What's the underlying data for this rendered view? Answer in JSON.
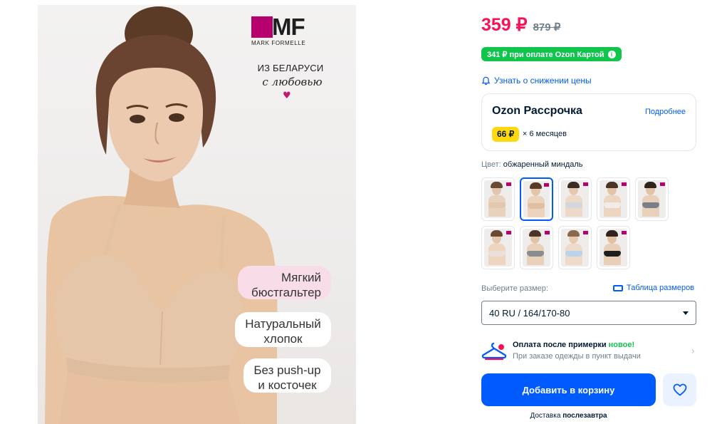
{
  "product_image": {
    "logo_letters": "MF",
    "logo_name": "MARK FORMELLE",
    "from_line": "ИЗ БЕЛАРУСИ",
    "love_line": "с любовью",
    "heart_icon": "heart-icon",
    "bubbles": [
      {
        "line1": "Мягкий",
        "line2": "бюстгальтер"
      },
      {
        "line1": "Натуральный",
        "line2": "хлопок"
      },
      {
        "line1": "Без push-up",
        "line2": "и косточек"
      }
    ]
  },
  "price": {
    "current": "359 ₽",
    "old": "879 ₽",
    "ozon_card_text": "341 ₽ при оплате Ozon Картой",
    "info_icon": "info-icon",
    "alert_text": "Узнать о снижении цены",
    "alert_icon": "bell-icon"
  },
  "installment": {
    "title": "Ozon Рассрочка",
    "more_link": "Подробнее",
    "amount": "66 ₽",
    "term": "× 6 месяцев"
  },
  "color": {
    "label": "Цвет:",
    "value": "обжаренный миндаль",
    "selected_index": 1,
    "swatches": [
      {
        "skin": "#e2c6ad",
        "hair": "#6b4a33",
        "body": "#e8d2bd",
        "bra": "#e3c8b0"
      },
      {
        "skin": "#e5c5a8",
        "hair": "#5a3b27",
        "body": "#ecd3bd",
        "bra": "#e2bfa0"
      },
      {
        "skin": "#e6c8ae",
        "hair": "#3d2c21",
        "body": "#edd9c7",
        "bra": "#d3d6dc"
      },
      {
        "skin": "#e4c4a6",
        "hair": "#4a3526",
        "body": "#ecd6c2",
        "bra": "#f1ece7"
      },
      {
        "skin": "#e3c3a5",
        "hair": "#2f231b",
        "body": "#e8d0ba",
        "bra": "#7b8088"
      },
      {
        "skin": "#e6c7ab",
        "hair": "#6b4a33",
        "body": "#edd5c0",
        "bra": "#eadfda"
      },
      {
        "skin": "#e3c3a6",
        "hair": "#4a3526",
        "body": "#e9d0bb",
        "bra": "#8a8c8f"
      },
      {
        "skin": "#e7cab0",
        "hair": "#8a6a4d",
        "body": "#eddacb",
        "bra": "#bcd1ea"
      },
      {
        "skin": "#e2c1a2",
        "hair": "#2f231b",
        "body": "#e9cfb8",
        "bra": "#1e1e1e"
      }
    ]
  },
  "size": {
    "label": "Выберите размер:",
    "table_link": "Таблица размеров",
    "table_icon": "ruler-icon",
    "selected": "40 RU / 164/170-80"
  },
  "try_on": {
    "title": "Оплата после примерки",
    "badge": "новое!",
    "subtitle": "При заказе одежды в пункт выдачи",
    "icon": "hanger-icon"
  },
  "actions": {
    "add_to_cart": "Добавить в корзину",
    "favorite_icon": "heart-outline-icon",
    "delivery_label": "Доставка",
    "delivery_value": "послезавтра"
  },
  "colors": {
    "accent": "#005bff",
    "price": "#f91155",
    "green": "#10c44c",
    "yellow": "#ffd90f",
    "brand": "#b5006e"
  }
}
